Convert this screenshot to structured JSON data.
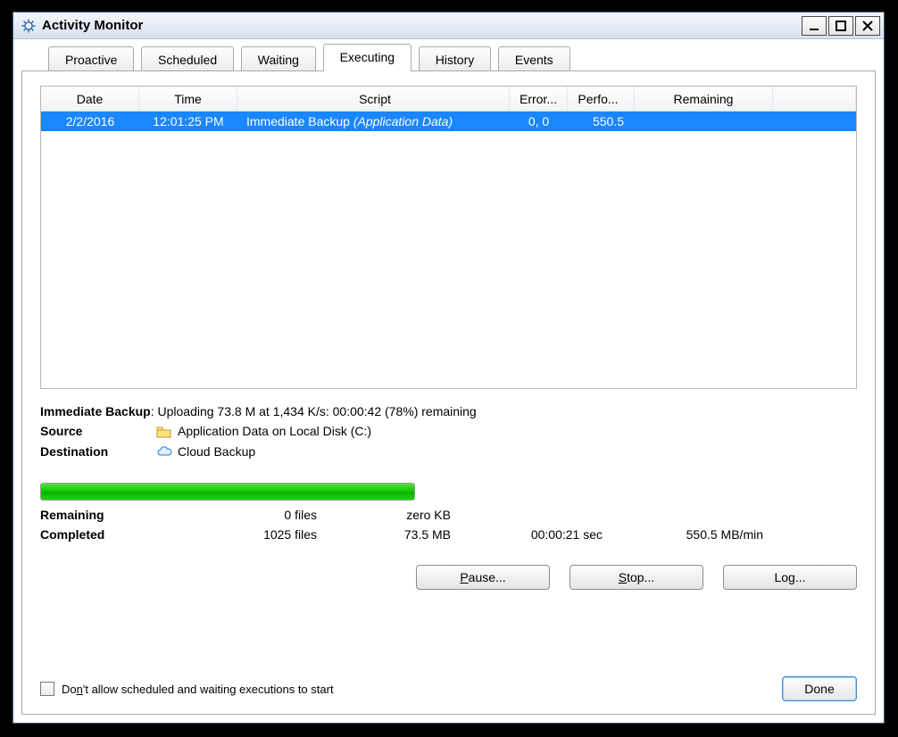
{
  "window": {
    "title": "Activity Monitor"
  },
  "tabs": [
    {
      "label": "Proactive",
      "active": false
    },
    {
      "label": "Scheduled",
      "active": false
    },
    {
      "label": "Waiting",
      "active": false
    },
    {
      "label": "Executing",
      "active": true
    },
    {
      "label": "History",
      "active": false
    },
    {
      "label": "Events",
      "active": false
    }
  ],
  "grid": {
    "columns": [
      "Date",
      "Time",
      "Script",
      "Error...",
      "Perfo...",
      "Remaining"
    ],
    "rows": [
      {
        "date": "2/2/2016",
        "time": "12:01:25 PM",
        "script_prefix": "Immediate Backup",
        "script_suffix": "(Application Data)",
        "errors": "0, 0",
        "perf": "550.5",
        "remaining": ""
      }
    ]
  },
  "status": {
    "backup_name": "Immediate Backup",
    "upload_line": ": Uploading 73.8 M at 1,434 K/s: 00:00:42 (78%) remaining",
    "source_label": "Source",
    "source_value": "Application Data on Local Disk (C:)",
    "dest_label": "Destination",
    "dest_value": "Cloud Backup"
  },
  "progress_percent": 100,
  "stats": {
    "remaining": {
      "label": "Remaining",
      "files": "0 files",
      "size": "zero KB",
      "time": "",
      "rate": ""
    },
    "completed": {
      "label": "Completed",
      "files": "1025 files",
      "size": "73.5 MB",
      "time": "00:00:21 sec",
      "rate": "550.5 MB/min"
    }
  },
  "buttons": {
    "pause": "Pause...",
    "stop": "Stop...",
    "log": "Log...",
    "done": "Done"
  },
  "footer": {
    "checkbox_label_pre": "Do",
    "checkbox_label_u": "n",
    "checkbox_label_post": "'t allow scheduled and waiting executions to start"
  }
}
